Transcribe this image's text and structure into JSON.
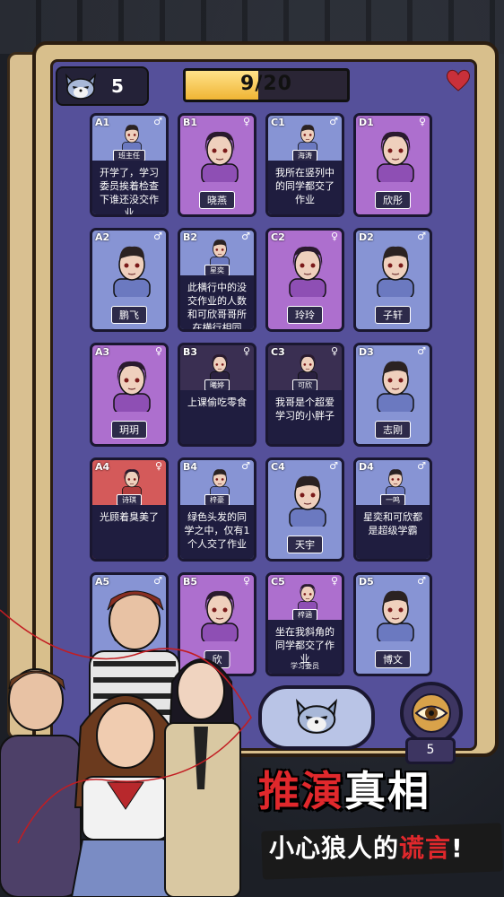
{
  "top_bar": {
    "cat_count": "5",
    "progress_text": "9/20",
    "progress_fraction": 0.45
  },
  "cards": [
    {
      "id": "A1",
      "gender": "♂",
      "color": "blue",
      "tag": "班主任",
      "statement": "开学了，学习委员挨着检查下谁还没交作业"
    },
    {
      "id": "B1",
      "gender": "♀",
      "color": "purple",
      "name": "晓燕"
    },
    {
      "id": "C1",
      "gender": "♂",
      "color": "blue",
      "tag": "海涛",
      "statement": "我所在竖列中的同学都交了作业"
    },
    {
      "id": "D1",
      "gender": "♀",
      "color": "purple",
      "name": "欣彤"
    },
    {
      "id": "A2",
      "gender": "♂",
      "color": "blue",
      "name": "鹏飞"
    },
    {
      "id": "B2",
      "gender": "♂",
      "color": "blue",
      "tag": "星奕",
      "statement": "此横行中的没交作业的人数和可欣哥哥所在横行相同"
    },
    {
      "id": "C2",
      "gender": "♀",
      "color": "purple",
      "name": "玲玲"
    },
    {
      "id": "D2",
      "gender": "♂",
      "color": "blue",
      "name": "子轩"
    },
    {
      "id": "A3",
      "gender": "♀",
      "color": "purple",
      "name": "玥玥"
    },
    {
      "id": "B3",
      "gender": "♀",
      "color": "dark",
      "tag": "曦婷",
      "statement": "上课偷吃零食"
    },
    {
      "id": "C3",
      "gender": "♀",
      "color": "dark",
      "tag": "可欣",
      "statement": "我哥是个超爱学习的小胖子"
    },
    {
      "id": "D3",
      "gender": "♂",
      "color": "blue",
      "name": "志刚"
    },
    {
      "id": "A4",
      "gender": "♀",
      "color": "red",
      "tag": "诗琪",
      "statement": "光顾着臭美了"
    },
    {
      "id": "B4",
      "gender": "♂",
      "color": "blue",
      "tag": "梓豪",
      "statement": "绿色头发的同学之中，仅有1个人交了作业"
    },
    {
      "id": "C4",
      "gender": "♂",
      "color": "blue",
      "name": "天宇"
    },
    {
      "id": "D4",
      "gender": "♂",
      "color": "blue",
      "tag": "一鸣",
      "statement": "星奕和可欣都是超级学霸"
    },
    {
      "id": "A5",
      "gender": "♂",
      "color": "blue",
      "name": ""
    },
    {
      "id": "B5",
      "gender": "♀",
      "color": "purple",
      "name": "欣"
    },
    {
      "id": "C5",
      "gender": "♀",
      "color": "purple",
      "tag": "梓涵",
      "statement": "坐在我斜角的同学都交了作业",
      "sub": "学习委员"
    },
    {
      "id": "D5",
      "gender": "♂",
      "color": "blue",
      "name": "博文"
    }
  ],
  "controls": {
    "eye_count": "5"
  },
  "banner": {
    "title_red": "推演",
    "title_white": "真相",
    "subtitle_white": "小心狼人的",
    "subtitle_red": "谎言",
    "subtitle_end": "!"
  },
  "colors": {
    "card_blue": "#8794d4",
    "card_purple": "#ad6fce",
    "card_red": "#d45a5a",
    "card_dark": "#3a2f52",
    "accent_red": "#e0282c",
    "progress_yellow": "#f0b534"
  }
}
